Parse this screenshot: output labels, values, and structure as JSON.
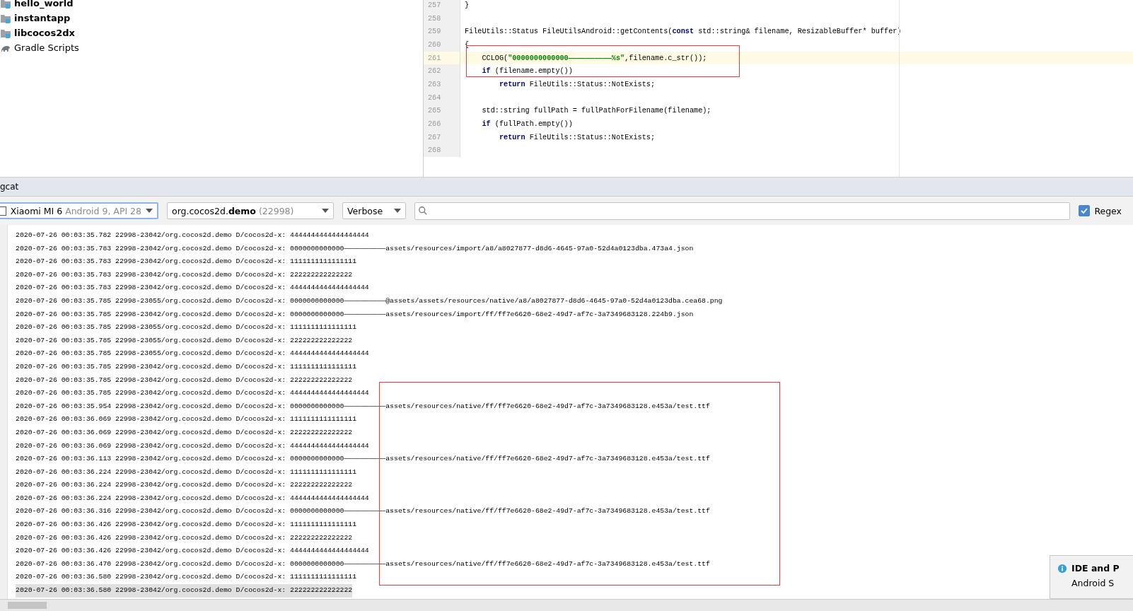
{
  "project_tree": {
    "items": [
      {
        "label": "hello_world",
        "kind": "module"
      },
      {
        "label": "instantapp",
        "kind": "module"
      },
      {
        "label": "libcocos2dx",
        "kind": "module"
      },
      {
        "label": "Gradle Scripts",
        "kind": "gradle"
      }
    ]
  },
  "editor": {
    "lines": [
      {
        "number": "257",
        "selected": false,
        "tokens": [
          {
            "kind": "plain",
            "text": "}"
          }
        ]
      },
      {
        "number": "258",
        "selected": false
      },
      {
        "number": "259",
        "selected": false,
        "tokens": [
          {
            "kind": "plain",
            "text": "FileUtils::Status FileUtilsAndroid::getContents("
          },
          {
            "kind": "keyword",
            "text": "const"
          },
          {
            "kind": "plain",
            "text": " std::string& filename, ResizableBuffer* buffer)"
          }
        ]
      },
      {
        "number": "260",
        "selected": false,
        "tokens": [
          {
            "kind": "plain",
            "text": "{"
          }
        ]
      },
      {
        "number": "261",
        "selected": true,
        "tokens": [
          {
            "kind": "plain",
            "text": "    CCLOG("
          },
          {
            "kind": "string",
            "text": "\"0000000000000——————————%s\""
          },
          {
            "kind": "plain",
            "text": ",filename.c_str());"
          }
        ]
      },
      {
        "number": "262",
        "selected": false,
        "tokens": [
          {
            "kind": "keyword",
            "text": "    if"
          },
          {
            "kind": "plain",
            "text": " (filename.empty())"
          }
        ]
      },
      {
        "number": "263",
        "selected": false,
        "tokens": [
          {
            "kind": "keyword",
            "text": "        return"
          },
          {
            "kind": "plain",
            "text": " FileUtils::Status::NotExists;"
          }
        ]
      },
      {
        "number": "264",
        "selected": false
      },
      {
        "number": "265",
        "selected": false,
        "tokens": [
          {
            "kind": "plain",
            "text": "    std::string fullPath = fullPathForFilename(filename);"
          }
        ]
      },
      {
        "number": "266",
        "selected": false,
        "tokens": [
          {
            "kind": "keyword",
            "text": "    if"
          },
          {
            "kind": "plain",
            "text": " (fullPath.empty())"
          }
        ]
      },
      {
        "number": "267",
        "selected": false,
        "tokens": [
          {
            "kind": "keyword",
            "text": "        return"
          },
          {
            "kind": "plain",
            "text": " FileUtils::Status::NotExists;"
          }
        ]
      },
      {
        "number": "268",
        "selected": false
      }
    ]
  },
  "logcat": {
    "title": "gcat",
    "device": {
      "name": "Xiaomi MI 6",
      "detail": "Android 9, API 28"
    },
    "process": {
      "label": "org.cocos2d.**demo**",
      "pid": "(22998)"
    },
    "level": "Verbose",
    "regex": {
      "label": "Regex",
      "checked": true
    },
    "rows": [
      {
        "prefix": "2020-07-26 00:03:35.782 22998-23042/org.cocos2d.demo D/cocos2d-x:",
        "message": "4444444444444444444",
        "selected": false
      },
      {
        "prefix": "2020-07-26 00:03:35.783 22998-23042/org.cocos2d.demo D/cocos2d-x:",
        "message": "0000000000000——————————assets/resources/import/a8/a8027877-d8d6-4645-97a0-52d4a0123dba.473a4.json",
        "selected": false
      },
      {
        "prefix": "2020-07-26 00:03:35.783 22998-23042/org.cocos2d.demo D/cocos2d-x:",
        "message": "1111111111111111",
        "selected": false
      },
      {
        "prefix": "2020-07-26 00:03:35.783 22998-23042/org.cocos2d.demo D/cocos2d-x:",
        "message": "222222222222222",
        "selected": false
      },
      {
        "prefix": "2020-07-26 00:03:35.783 22998-23042/org.cocos2d.demo D/cocos2d-x:",
        "message": "4444444444444444444",
        "selected": false
      },
      {
        "prefix": "2020-07-26 00:03:35.785 22998-23055/org.cocos2d.demo D/cocos2d-x:",
        "message": "0000000000000——————————@assets/assets/resources/native/a8/a8027877-d8d6-4645-97a0-52d4a0123dba.cea68.png",
        "selected": false
      },
      {
        "prefix": "2020-07-26 00:03:35.785 22998-23042/org.cocos2d.demo D/cocos2d-x:",
        "message": "0000000000000——————————assets/resources/import/ff/ff7e6620-68e2-49d7-af7c-3a7349683128.224b9.json",
        "selected": false
      },
      {
        "prefix": "2020-07-26 00:03:35.785 22998-23055/org.cocos2d.demo D/cocos2d-x:",
        "message": "1111111111111111",
        "selected": false
      },
      {
        "prefix": "2020-07-26 00:03:35.785 22998-23055/org.cocos2d.demo D/cocos2d-x:",
        "message": "222222222222222",
        "selected": false
      },
      {
        "prefix": "2020-07-26 00:03:35.785 22998-23055/org.cocos2d.demo D/cocos2d-x:",
        "message": "4444444444444444444",
        "selected": false
      },
      {
        "prefix": "2020-07-26 00:03:35.785 22998-23042/org.cocos2d.demo D/cocos2d-x:",
        "message": "1111111111111111",
        "selected": false
      },
      {
        "prefix": "2020-07-26 00:03:35.785 22998-23042/org.cocos2d.demo D/cocos2d-x:",
        "message": "222222222222222",
        "selected": false
      },
      {
        "prefix": "2020-07-26 00:03:35.785 22998-23042/org.cocos2d.demo D/cocos2d-x:",
        "message": "4444444444444444444",
        "selected": false
      },
      {
        "prefix": "2020-07-26 00:03:35.954 22998-23042/org.cocos2d.demo D/cocos2d-x:",
        "message": "0000000000000——————————assets/resources/native/ff/ff7e6620-68e2-49d7-af7c-3a7349683128.e453a/test.ttf",
        "selected": false
      },
      {
        "prefix": "2020-07-26 00:03:36.069 22998-23042/org.cocos2d.demo D/cocos2d-x:",
        "message": "1111111111111111",
        "selected": false
      },
      {
        "prefix": "2020-07-26 00:03:36.069 22998-23042/org.cocos2d.demo D/cocos2d-x:",
        "message": "222222222222222",
        "selected": false
      },
      {
        "prefix": "2020-07-26 00:03:36.069 22998-23042/org.cocos2d.demo D/cocos2d-x:",
        "message": "4444444444444444444",
        "selected": false
      },
      {
        "prefix": "2020-07-26 00:03:36.113 22998-23042/org.cocos2d.demo D/cocos2d-x:",
        "message": "0000000000000——————————assets/resources/native/ff/ff7e6620-68e2-49d7-af7c-3a7349683128.e453a/test.ttf",
        "selected": false
      },
      {
        "prefix": "2020-07-26 00:03:36.224 22998-23042/org.cocos2d.demo D/cocos2d-x:",
        "message": "1111111111111111",
        "selected": false
      },
      {
        "prefix": "2020-07-26 00:03:36.224 22998-23042/org.cocos2d.demo D/cocos2d-x:",
        "message": "222222222222222",
        "selected": false
      },
      {
        "prefix": "2020-07-26 00:03:36.224 22998-23042/org.cocos2d.demo D/cocos2d-x:",
        "message": "4444444444444444444",
        "selected": false
      },
      {
        "prefix": "2020-07-26 00:03:36.316 22998-23042/org.cocos2d.demo D/cocos2d-x:",
        "message": "0000000000000——————————assets/resources/native/ff/ff7e6620-68e2-49d7-af7c-3a7349683128.e453a/test.ttf",
        "selected": false
      },
      {
        "prefix": "2020-07-26 00:03:36.426 22998-23042/org.cocos2d.demo D/cocos2d-x:",
        "message": "1111111111111111",
        "selected": false
      },
      {
        "prefix": "2020-07-26 00:03:36.426 22998-23042/org.cocos2d.demo D/cocos2d-x:",
        "message": "222222222222222",
        "selected": false
      },
      {
        "prefix": "2020-07-26 00:03:36.426 22998-23042/org.cocos2d.demo D/cocos2d-x:",
        "message": "4444444444444444444",
        "selected": false
      },
      {
        "prefix": "2020-07-26 00:03:36.470 22998-23042/org.cocos2d.demo D/cocos2d-x:",
        "message": "0000000000000——————————assets/resources/native/ff/ff7e6620-68e2-49d7-af7c-3a7349683128.e453a/test.ttf",
        "selected": false
      },
      {
        "prefix": "2020-07-26 00:03:36.580 22998-23042/org.cocos2d.demo D/cocos2d-x:",
        "message": "1111111111111111",
        "selected": false
      },
      {
        "prefix": "2020-07-26 00:03:36.580 22998-23042/org.cocos2d.demo D/cocos2d-x:",
        "message": "222222222222222",
        "selected": true
      }
    ]
  },
  "notification": {
    "title": "IDE and P",
    "body": "Android S"
  }
}
